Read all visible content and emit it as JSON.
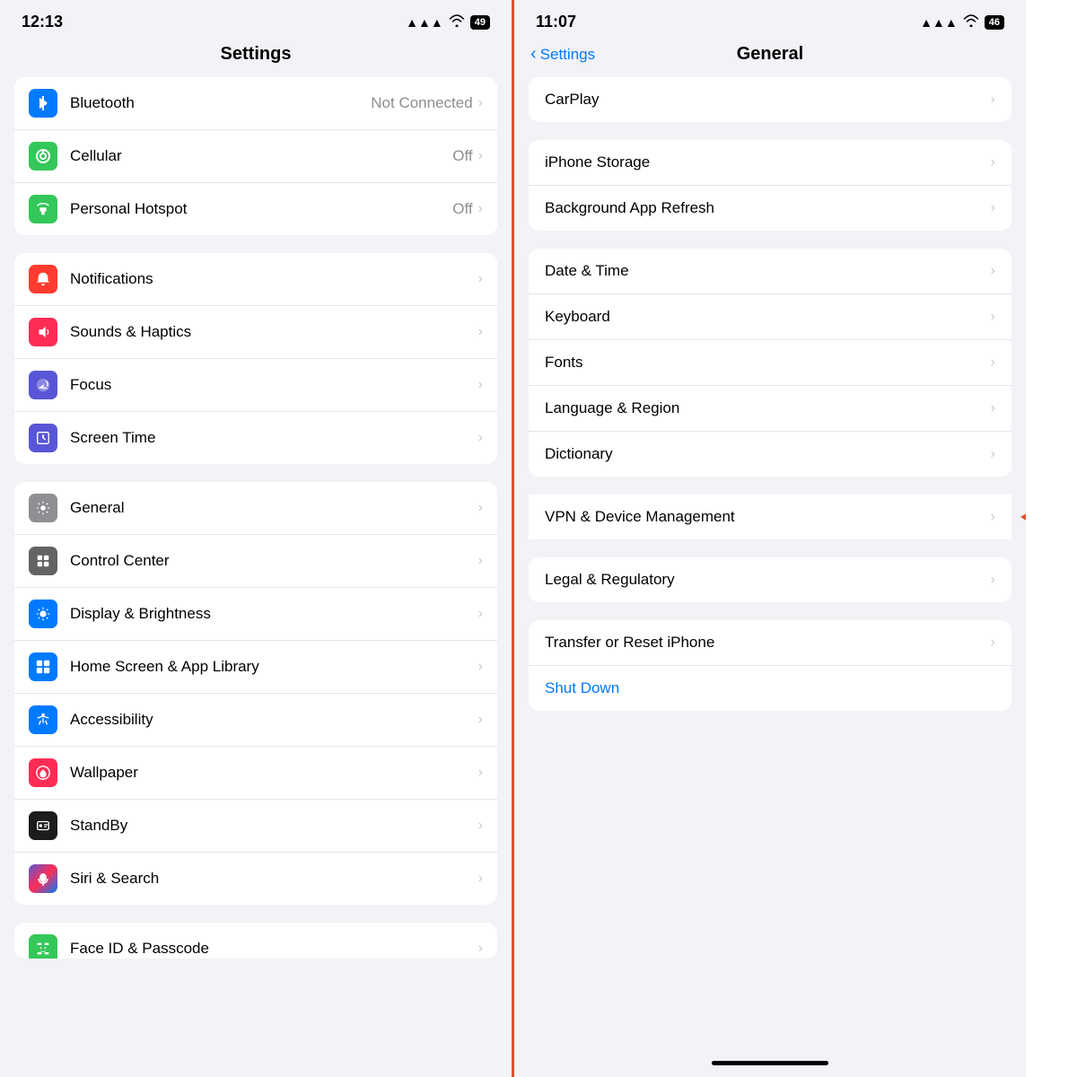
{
  "left_panel": {
    "status": {
      "time": "12:13",
      "signal": "▲▲▲",
      "wifi": "WiFi",
      "battery": "49"
    },
    "title": "Settings",
    "groups": [
      {
        "id": "connectivity",
        "items": [
          {
            "id": "bluetooth",
            "icon": "bluetooth",
            "icon_color": "icon-blue",
            "icon_char": "𝐁",
            "label": "Bluetooth",
            "value": "Not Connected",
            "chevron": ">"
          },
          {
            "id": "cellular",
            "icon": "cellular",
            "icon_color": "icon-green",
            "icon_char": "((·))",
            "label": "Cellular",
            "value": "Off",
            "chevron": ">"
          },
          {
            "id": "hotspot",
            "icon": "hotspot",
            "icon_color": "icon-green2",
            "icon_char": "⛓",
            "label": "Personal Hotspot",
            "value": "Off",
            "chevron": ">"
          }
        ]
      },
      {
        "id": "alerts",
        "items": [
          {
            "id": "notifications",
            "icon": "bell",
            "icon_color": "icon-red",
            "icon_char": "🔔",
            "label": "Notifications",
            "value": "",
            "chevron": ">"
          },
          {
            "id": "sounds",
            "icon": "sound",
            "icon_color": "icon-pink",
            "icon_char": "🔊",
            "label": "Sounds & Haptics",
            "value": "",
            "chevron": ">"
          },
          {
            "id": "focus",
            "icon": "moon",
            "icon_color": "icon-purple",
            "icon_char": "🌙",
            "label": "Focus",
            "value": "",
            "chevron": ">"
          },
          {
            "id": "screentime",
            "icon": "hourglass",
            "icon_color": "icon-purple",
            "icon_char": "⏳",
            "label": "Screen Time",
            "value": "",
            "chevron": ">"
          }
        ]
      },
      {
        "id": "system",
        "items": [
          {
            "id": "general",
            "icon": "gear",
            "icon_color": "icon-gray",
            "icon_char": "⚙",
            "label": "General",
            "value": "",
            "chevron": ">",
            "arrow": true
          },
          {
            "id": "controlcenter",
            "icon": "sliders",
            "icon_color": "icon-darkgray",
            "icon_char": "▤",
            "label": "Control Center",
            "value": "",
            "chevron": ">"
          },
          {
            "id": "display",
            "icon": "sun",
            "icon_color": "icon-blue",
            "icon_char": "☀",
            "label": "Display & Brightness",
            "value": "",
            "chevron": ">"
          },
          {
            "id": "homescreen",
            "icon": "grid",
            "icon_color": "icon-blue",
            "icon_char": "⊞",
            "label": "Home Screen & App Library",
            "value": "",
            "chevron": ">"
          },
          {
            "id": "accessibility",
            "icon": "accessibility",
            "icon_color": "icon-blue",
            "icon_char": "♿",
            "label": "Accessibility",
            "value": "",
            "chevron": ">"
          },
          {
            "id": "wallpaper",
            "icon": "flower",
            "icon_color": "icon-pink",
            "icon_char": "✿",
            "label": "Wallpaper",
            "value": "",
            "chevron": ">"
          },
          {
            "id": "standby",
            "icon": "standby",
            "icon_color": "icon-black",
            "icon_char": "⏏",
            "label": "StandBy",
            "value": "",
            "chevron": ">"
          },
          {
            "id": "siri",
            "icon": "siri",
            "icon_color": "icon-purple",
            "icon_char": "◎",
            "label": "Siri & Search",
            "value": "",
            "chevron": ">"
          }
        ]
      },
      {
        "id": "security_clipped",
        "items": [
          {
            "id": "faceid",
            "icon": "faceid",
            "icon_color": "icon-green",
            "icon_char": "⊡",
            "label": "Face ID & Passcode",
            "value": "",
            "chevron": ">"
          }
        ]
      }
    ]
  },
  "right_panel": {
    "status": {
      "time": "11:07",
      "signal": "▲▲▲",
      "wifi": "WiFi",
      "battery": "46"
    },
    "back_label": "Settings",
    "title": "General",
    "groups": [
      {
        "id": "carplay_group",
        "items": [
          {
            "id": "carplay",
            "label": "CarPlay",
            "chevron": ">"
          }
        ]
      },
      {
        "id": "storage_group",
        "items": [
          {
            "id": "iphone_storage",
            "label": "iPhone Storage",
            "chevron": ">"
          },
          {
            "id": "bg_refresh",
            "label": "Background App Refresh",
            "chevron": ">"
          }
        ]
      },
      {
        "id": "locale_group",
        "items": [
          {
            "id": "datetime",
            "label": "Date & Time",
            "chevron": ">"
          },
          {
            "id": "keyboard",
            "label": "Keyboard",
            "chevron": ">"
          },
          {
            "id": "fonts",
            "label": "Fonts",
            "chevron": ">"
          },
          {
            "id": "language",
            "label": "Language & Region",
            "chevron": ">"
          },
          {
            "id": "dictionary",
            "label": "Dictionary",
            "chevron": ">"
          }
        ]
      },
      {
        "id": "vpn_group",
        "items": [
          {
            "id": "vpn",
            "label": "VPN & Device Management",
            "chevron": ">",
            "arrow": true
          }
        ]
      },
      {
        "id": "legal_group",
        "items": [
          {
            "id": "legal",
            "label": "Legal & Regulatory",
            "chevron": ">"
          }
        ]
      },
      {
        "id": "reset_group",
        "items": [
          {
            "id": "transfer",
            "label": "Transfer or Reset iPhone",
            "chevron": ">"
          },
          {
            "id": "shutdown",
            "label": "Shut Down",
            "chevron": "",
            "blue": true
          }
        ]
      }
    ],
    "home_bar": "─"
  }
}
